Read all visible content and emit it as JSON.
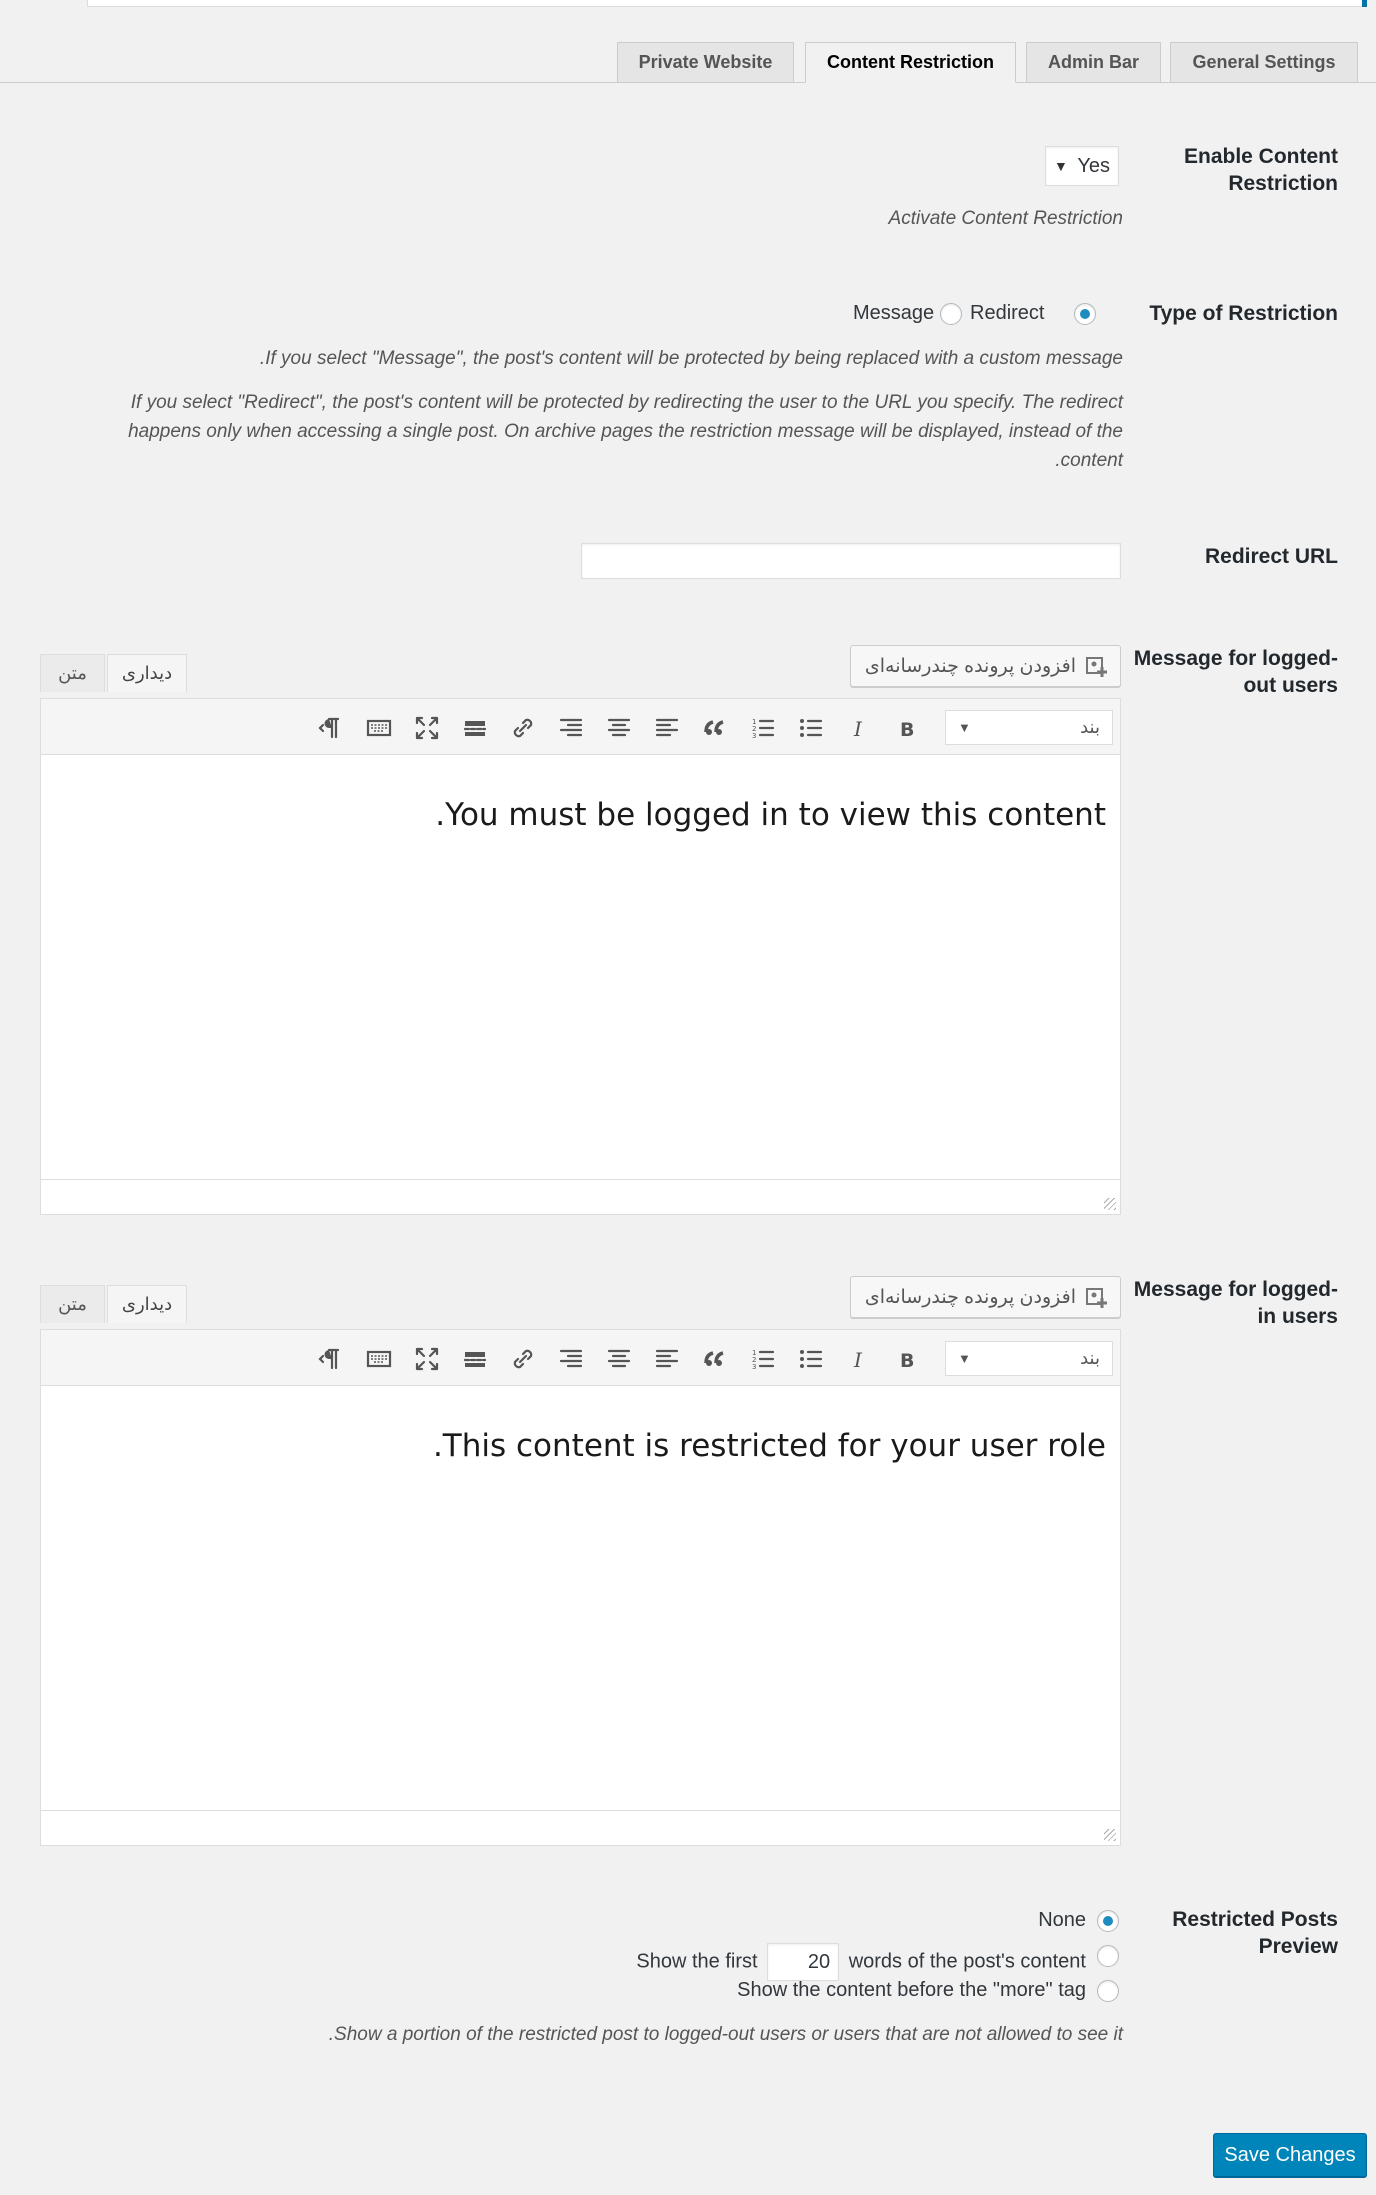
{
  "tabs": [
    {
      "label": "Private Website",
      "active": false
    },
    {
      "label": "Content Restriction",
      "active": true
    },
    {
      "label": "Admin Bar",
      "active": false
    },
    {
      "label": "General Settings",
      "active": false
    }
  ],
  "enable": {
    "label_line1": "Enable Content",
    "label_line2": "Restriction",
    "value": "Yes",
    "description": "Activate Content Restriction"
  },
  "restriction_type": {
    "label": "Type of Restriction",
    "options": [
      "Message",
      "Redirect"
    ],
    "selected": "Redirect",
    "desc_message": ".If you select \"Message\", the post's content will be protected by being replaced with a custom message",
    "desc_redirect_1": "If you select \"Redirect\", the post's content will be protected by redirecting the user to the URL you specify. The redirect",
    "desc_redirect_2": "happens only when accessing a single post. On archive pages the restriction message will be displayed, instead of the",
    "desc_redirect_3": ".content"
  },
  "redirect_url": {
    "label": "Redirect URL",
    "value": ""
  },
  "editor_common": {
    "add_media": "افزودن پرونده چندرسانه‌ای",
    "tab_visual": "دیداری",
    "tab_text": "متن",
    "format": "بند",
    "toolbar_icons": [
      "paragraph-icon",
      "keyboard-icon",
      "fullscreen-icon",
      "read-more-icon",
      "link-icon",
      "align-right-icon",
      "align-center-icon",
      "align-left-icon",
      "blockquote-icon",
      "numbered-list-icon",
      "bullet-list-icon",
      "italic-icon",
      "bold-icon"
    ]
  },
  "logged_out": {
    "label_line1": "Message for logged-",
    "label_line2": "out users",
    "content": ".You must be logged in to view this content"
  },
  "logged_in": {
    "label_line1": "Message for logged-",
    "label_line2": "in users",
    "content": ".This content is restricted for your user role"
  },
  "preview": {
    "label_line1": "Restricted Posts",
    "label_line2": "Preview",
    "opt_none": "None",
    "opt_first_a": "Show the first",
    "opt_first_value": "20",
    "opt_first_b": "words of the post's content",
    "opt_more": "Show the content before the \"more\" tag",
    "selected": "None",
    "description": ".Show a portion of the restricted post to logged-out users or users that are not allowed to see it"
  },
  "save_label": "Save Changes",
  "accent_color": "#0085ba"
}
